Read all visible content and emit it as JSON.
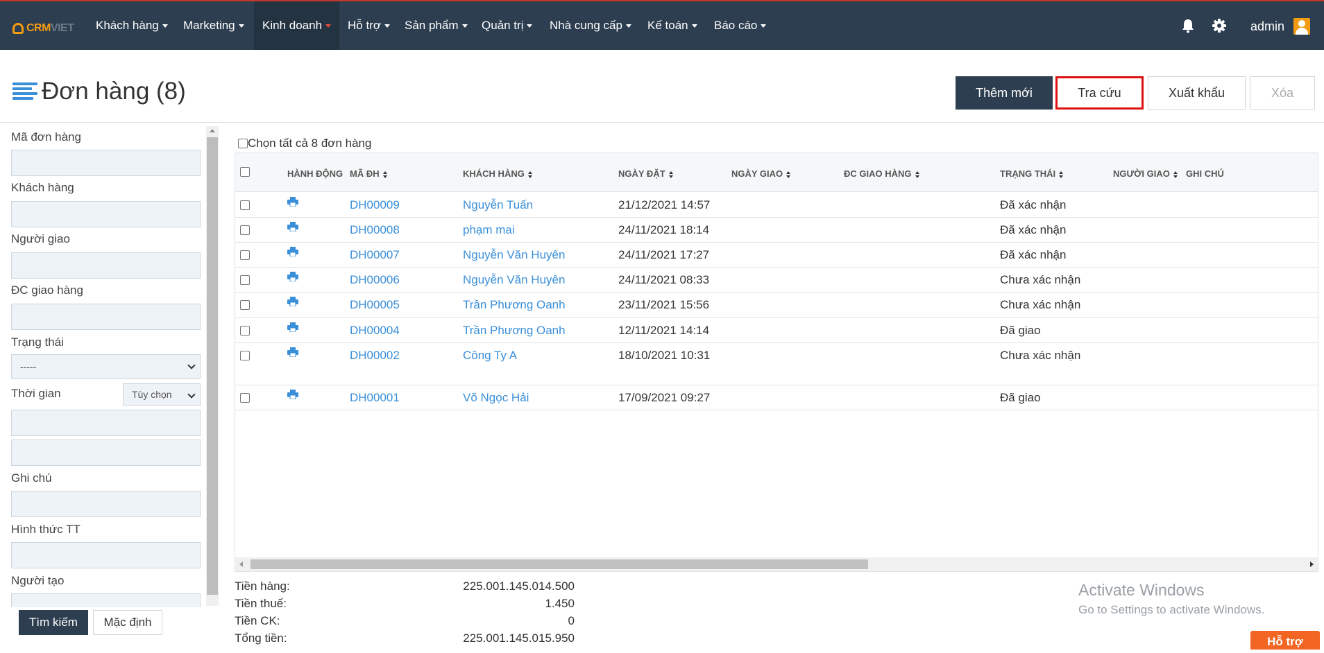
{
  "logo": {
    "part1": "CRM",
    "part2": "VIET"
  },
  "nav": {
    "items": [
      {
        "label": "Khách hàng"
      },
      {
        "label": "Marketing"
      },
      {
        "label": "Kinh doanh"
      },
      {
        "label": "Hỗ trợ"
      },
      {
        "label": "Sản phẩm"
      },
      {
        "label": "Quản trị"
      },
      {
        "label": "Nhà cung cấp"
      },
      {
        "label": "Kế toán"
      },
      {
        "label": "Báo cáo"
      }
    ],
    "user": "admin",
    "bell_icon": "bell-icon",
    "settings_icon": "gear-icon"
  },
  "page": {
    "title": "Đơn hàng (8)",
    "buttons": {
      "add": "Thêm mới",
      "search": "Tra cứu",
      "export": "Xuất khẩu",
      "delete": "Xóa"
    }
  },
  "sidebar": {
    "fields": {
      "order_code": "Mã đơn hàng",
      "customer": "Khách hàng",
      "deliverer": "Người giao",
      "address": "ĐC giao hàng",
      "status": "Trạng thái",
      "status_value": "-----",
      "time": "Thời gian",
      "time_option": "Tùy chọn",
      "note": "Ghi chú",
      "payment": "Hình thức TT",
      "creator": "Người tạo"
    },
    "buttons": {
      "search": "Tìm kiếm",
      "default": "Mặc định"
    }
  },
  "table": {
    "select_all": "Chọn tất cả 8 đơn hàng",
    "columns": {
      "action": "HÀNH ĐỘNG",
      "code": "MÃ ĐH",
      "customer": "KHÁCH HÀNG",
      "order_date": "NGÀY ĐẶT",
      "delivery_date": "NGÀY GIAO",
      "address": "ĐC GIAO HÀNG",
      "status": "TRẠNG THÁI",
      "deliverer": "NGƯỜI GIAO",
      "note": "GHI CHÚ"
    },
    "rows": [
      {
        "code": "DH00009",
        "customer": "Nguyễn Tuấn",
        "order_date": "21/12/2021 14:57",
        "status": "Đã xác nhận"
      },
      {
        "code": "DH00008",
        "customer": "phạm mai",
        "order_date": "24/11/2021 18:14",
        "status": "Đã xác nhận"
      },
      {
        "code": "DH00007",
        "customer": "Nguyễn Văn Huyên",
        "order_date": "24/11/2021 17:27",
        "status": "Đã xác nhận"
      },
      {
        "code": "DH00006",
        "customer": "Nguyễn Văn Huyên",
        "order_date": "24/11/2021 08:33",
        "status": "Chưa xác nhận"
      },
      {
        "code": "DH00005",
        "customer": "Trần Phương Oanh",
        "order_date": "23/11/2021 15:56",
        "status": "Chưa xác nhận"
      },
      {
        "code": "DH00004",
        "customer": "Trần Phương Oanh",
        "order_date": "12/11/2021 14:14",
        "status": "Đã giao"
      },
      {
        "code": "DH00002",
        "customer": "Công Ty A",
        "order_date": "18/10/2021 10:31",
        "status": "Chưa xác nhận"
      },
      {
        "code": "DH00001",
        "customer": "Võ Ngọc Hải",
        "order_date": "17/09/2021 09:27",
        "status": "Đã giao"
      }
    ]
  },
  "totals": {
    "goods_label": "Tiền hàng:",
    "goods_value": "225.001.145.014.500",
    "tax_label": "Tiền thuế:",
    "tax_value": "1.450",
    "discount_label": "Tiền CK:",
    "discount_value": "0",
    "total_label": "Tổng tiền:",
    "total_value": "225.001.145.015.950"
  },
  "watermark": {
    "line1": "Activate Windows",
    "line2": "Go to Settings to activate Windows."
  },
  "support": "Hỗ trợ",
  "colors": {
    "nav_bg": "#2d3e50",
    "accent_orange": "#f39c12",
    "link_blue": "#3a8fd9",
    "highlight_red": "#e01010",
    "support_orange": "#f26522"
  }
}
